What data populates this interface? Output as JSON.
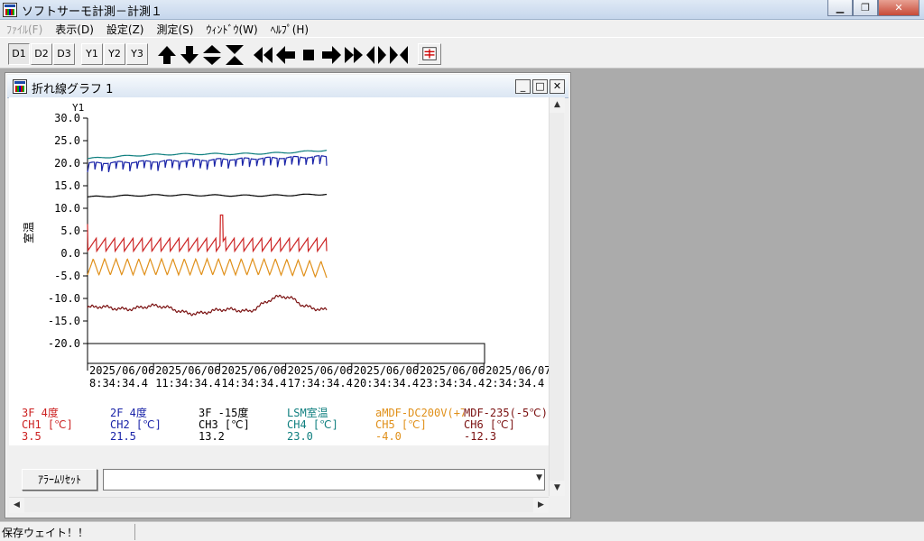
{
  "window": {
    "title": "ソフトサーモ計測－計測１"
  },
  "menu": [
    {
      "label": "ﾌｧｲﾙ(F)",
      "disabled": true
    },
    {
      "label": "表示(D)"
    },
    {
      "label": "設定(Z)"
    },
    {
      "label": "測定(S)"
    },
    {
      "label": "ｳｨﾝﾄﾞｳ(W)"
    },
    {
      "label": "ﾍﾙﾌﾟ(H)"
    }
  ],
  "toolbar": {
    "buttons": [
      "D1",
      "D2",
      "D3",
      "Y1",
      "Y2",
      "Y3"
    ],
    "icons": [
      "arrow-up-icon",
      "arrow-down-icon",
      "expand-vertical-icon",
      "shrink-vertical-icon",
      "rewind-icon",
      "step-back-icon",
      "stop-icon",
      "step-forward-icon",
      "fast-forward-icon",
      "expand-horizontal-icon",
      "shrink-horizontal-icon",
      "print-icon"
    ]
  },
  "child": {
    "title": "折れ線グラフ 1"
  },
  "chart_data": {
    "type": "line",
    "y_axis_name": "Y1",
    "ylabel": "室温",
    "ylim": [
      -20,
      30
    ],
    "yticks": [
      "30.0",
      "25.0",
      "20.0",
      "15.0",
      "10.0",
      "5.0",
      "0.0",
      "-5.0",
      "-10.0",
      "-15.0",
      "-20.0"
    ],
    "ytick_values": [
      30,
      25,
      20,
      15,
      10,
      5,
      0,
      -5,
      -10,
      -15,
      -20
    ],
    "xticks": [
      {
        "date": "2025/06/06",
        "time": "8:34:34.4"
      },
      {
        "date": "2025/06/06",
        "time": "11:34:34.4"
      },
      {
        "date": "2025/06/06",
        "time": "14:34:34.4"
      },
      {
        "date": "2025/06/06",
        "time": "17:34:34.4"
      },
      {
        "date": "2025/06/06",
        "time": "20:34:34.4"
      },
      {
        "date": "2025/06/06",
        "time": "23:34:34.4"
      },
      {
        "date": "2025/06/07",
        "time": "2:34:34.4"
      }
    ],
    "series": [
      {
        "name": "3F 4度",
        "channel": "CH1 [℃]",
        "current": "3.5",
        "color": "#cc2222",
        "pattern": "sawtooth",
        "base": 0.5,
        "amp": 3.0,
        "end": 3.5,
        "spike": 8.5
      },
      {
        "name": "2F 4度",
        "channel": "CH2 [℃]",
        "current": "21.5",
        "color": "#1a24a8",
        "pattern": "dips",
        "base": 20.0,
        "amp": 2.0,
        "end": 21.5
      },
      {
        "name": "3F -15度",
        "channel": "CH3 [℃]",
        "current": "13.2",
        "color": "#000000",
        "pattern": "smooth",
        "base": 12.5,
        "amp": 0.5,
        "end": 13.2
      },
      {
        "name": "LSM室温",
        "channel": "CH4 [℃]",
        "current": "23.0",
        "color": "#0f7f7f",
        "pattern": "smooth",
        "base": 21.0,
        "amp": 0.8,
        "end": 23.0
      },
      {
        "name": "aMDF-DC200V(+7",
        "channel": "CH5 [℃]",
        "current": "-4.0",
        "color": "#e0901a",
        "pattern": "triangle",
        "base": -3.0,
        "amp": 1.8,
        "end": -4.0
      },
      {
        "name": "MDF-235(-5℃)",
        "channel": "CH6 [℃]",
        "current": "-12.3",
        "color": "#7a1010",
        "pattern": "wander",
        "base": -12.5,
        "amp": 1.0,
        "end": -12.3
      }
    ]
  },
  "alarm": {
    "reset_label": "ｱﾗｰﾑﾘｾｯﾄ",
    "field_value": ""
  },
  "status": {
    "text": "保存ウェイト！！"
  }
}
